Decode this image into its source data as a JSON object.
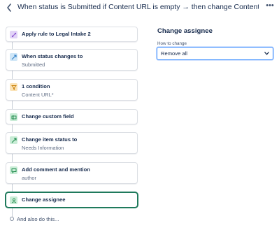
{
  "header": {
    "title": "When status is Submitted if Content URL is empty → then change Content URL to RE",
    "more_label": "•••"
  },
  "steps": [
    {
      "title": "Apply rule to Legal Intake 2",
      "subtitle": "",
      "icon": "share-branch-icon",
      "color": "#e2d4f7"
    },
    {
      "title": "When status changes to",
      "subtitle": "Submitted",
      "icon": "trigger-arrow-icon",
      "color": "#cfe6f7"
    },
    {
      "title": "1 condition",
      "subtitle": "Content URL*",
      "icon": "filter-icon",
      "color": "#fbe3b7"
    },
    {
      "title": "Change custom field",
      "subtitle": "",
      "icon": "custom-field-icon",
      "color": "#c9ecd6"
    },
    {
      "title": "Change item status to",
      "subtitle": "Needs Information",
      "icon": "status-arrow-icon",
      "color": "#c9ecd6"
    },
    {
      "title": "Add comment and mention",
      "subtitle": "author",
      "icon": "comment-icon",
      "color": "#c9ecd6"
    },
    {
      "title": "Change assignee",
      "subtitle": "",
      "icon": "person-icon",
      "color": "#c9ecd6"
    }
  ],
  "add_more": {
    "label": "And also do this..."
  },
  "panel": {
    "title": "Change assignee",
    "field_label": "How to change",
    "select_value": "Remove all"
  }
}
